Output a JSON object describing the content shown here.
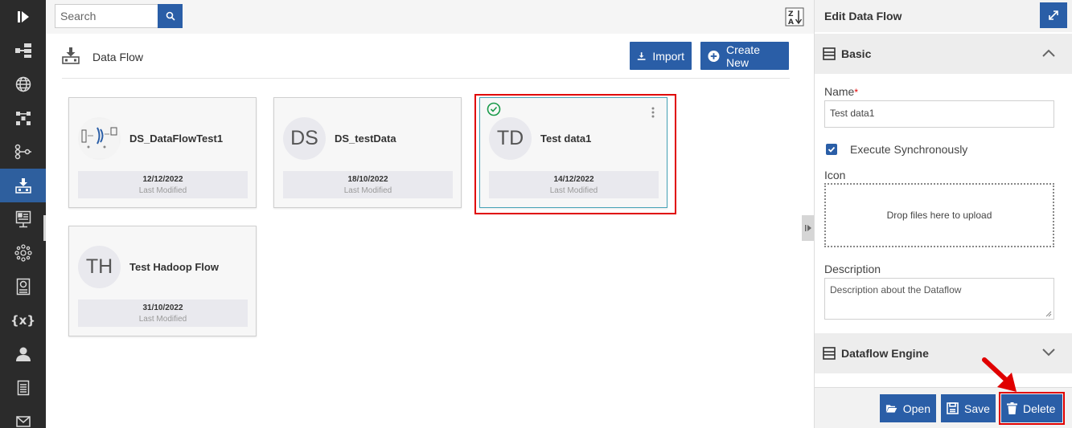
{
  "sidebar": {
    "items": [
      {
        "icon": "collapse-sidebar-icon"
      },
      {
        "icon": "hierarchy-icon"
      },
      {
        "icon": "globe-icon"
      },
      {
        "icon": "network-icon"
      },
      {
        "icon": "pipeline-icon"
      },
      {
        "icon": "dataflow-icon",
        "active": true
      },
      {
        "icon": "dashboard-icon"
      },
      {
        "icon": "cluster-icon"
      },
      {
        "icon": "report-icon"
      },
      {
        "icon": "variables-icon",
        "glyph": "{x}"
      },
      {
        "icon": "user-icon"
      },
      {
        "icon": "document-icon"
      },
      {
        "icon": "mail-icon"
      }
    ]
  },
  "search": {
    "placeholder": "Search"
  },
  "header": {
    "title": "Data Flow",
    "import_label": "Import",
    "create_label": "Create New"
  },
  "cards": [
    {
      "title": "DS_DataFlowTest1",
      "avatar": "",
      "date": "12/12/2022",
      "modified_label": "Last Modified"
    },
    {
      "title": "DS_testData",
      "avatar": "DS",
      "date": "18/10/2022",
      "modified_label": "Last Modified"
    },
    {
      "title": "Test data1",
      "avatar": "TD",
      "date": "14/12/2022",
      "modified_label": "Last Modified",
      "selected": true
    },
    {
      "title": "Test Hadoop Flow",
      "avatar": "TH",
      "date": "31/10/2022",
      "modified_label": "Last Modified"
    }
  ],
  "panel": {
    "title": "Edit Data Flow",
    "basic_section": "Basic",
    "name_label": "Name",
    "name_required": "*",
    "name_value": "Test data1",
    "execute_label": "Execute Synchronously",
    "execute_checked": true,
    "icon_label": "Icon",
    "dropzone_text": "Drop files here to upload",
    "description_label": "Description",
    "description_placeholder": "Description about the Dataflow",
    "engine_section": "Dataflow Engine",
    "open_label": "Open",
    "save_label": "Save",
    "delete_label": "Delete"
  },
  "colors": {
    "accent": "#2a5ea7",
    "sidebar_bg": "#2b2b2b",
    "highlight": "#e00000",
    "selected_check": "#1a9a4a"
  }
}
